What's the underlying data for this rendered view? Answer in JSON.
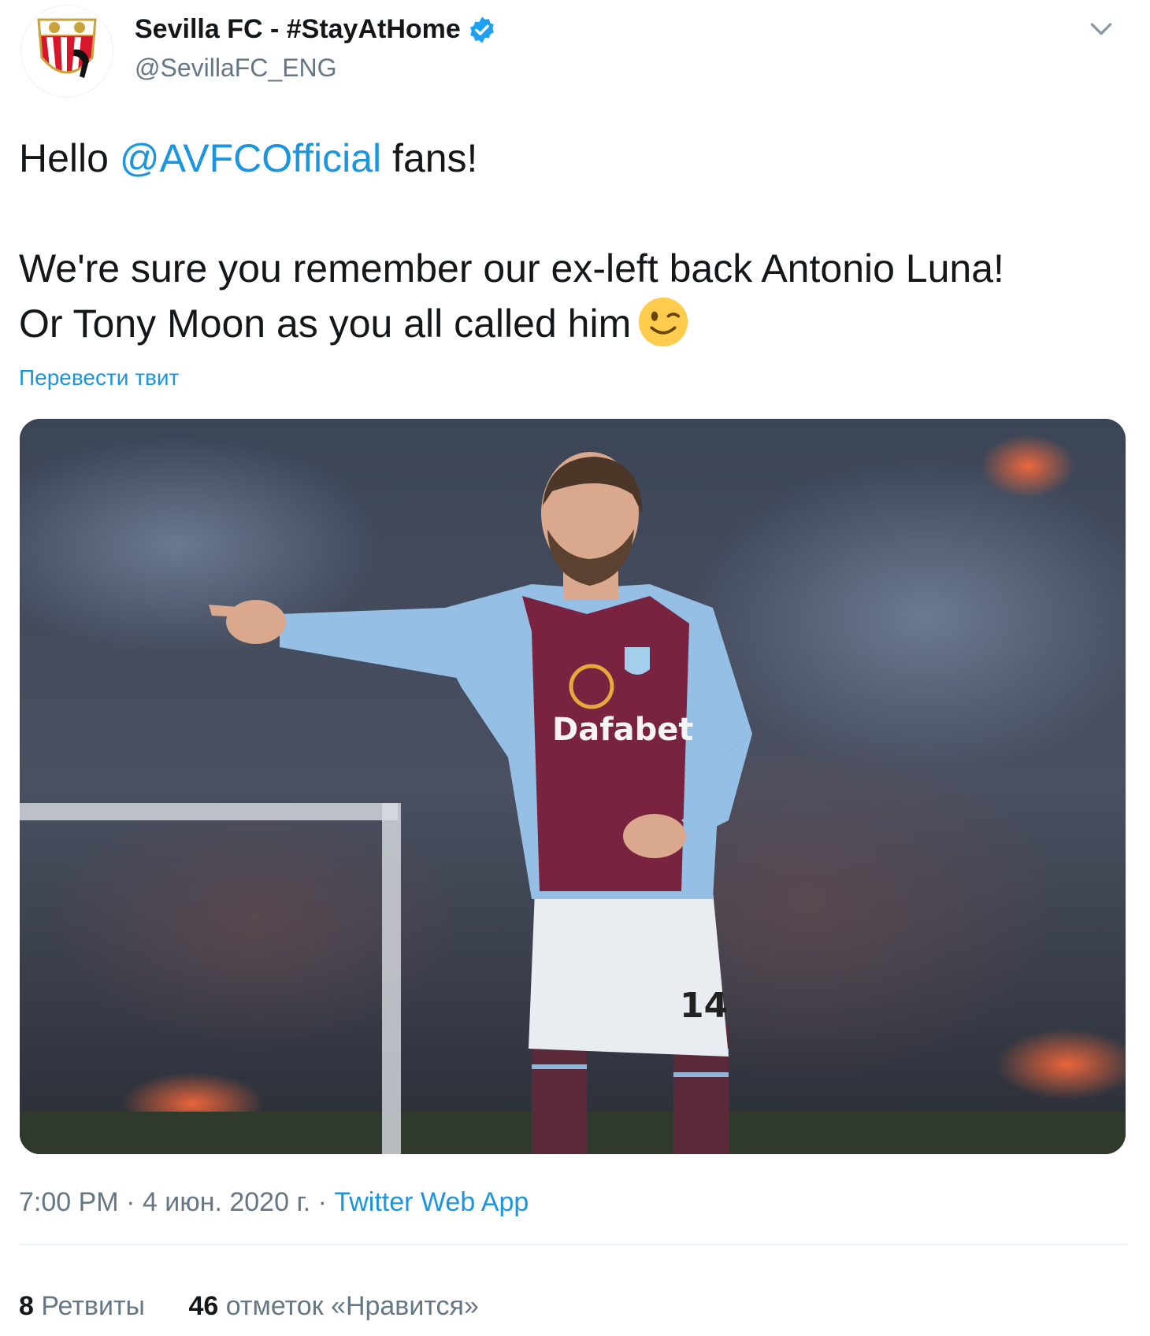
{
  "author": {
    "display_name": "Sevilla FC - #StayAtHome",
    "handle": "@SevillaFC_ENG",
    "verified_icon": "verified-badge-icon",
    "avatar_icon": "sevilla-crest-icon"
  },
  "tweet": {
    "line1_prefix": "Hello ",
    "mention": "@AVFCOfficial",
    "line1_suffix": " fans!",
    "line2": "We're sure you remember our ex-left back Antonio Luna! Or Tony Moon as you all called him",
    "emoji": "winking-face-icon"
  },
  "translate_label": "Перевести твит",
  "photo": {
    "shirt_sponsor": "Dafabet",
    "shirt_number": "14"
  },
  "meta": {
    "time": "7:00 PM",
    "separator": " · ",
    "date": "4 июн. 2020 г.",
    "source": "Twitter Web App"
  },
  "stats": {
    "retweets_count": "8",
    "retweets_label": "Ретвиты",
    "likes_count": "46",
    "likes_label": "отметок «Нравится»"
  },
  "colors": {
    "link": "#1b95e0",
    "secondary_text": "#657786",
    "primary_text": "#14171a",
    "claret": "#7a2340",
    "sky_blue": "#95bfe5"
  }
}
